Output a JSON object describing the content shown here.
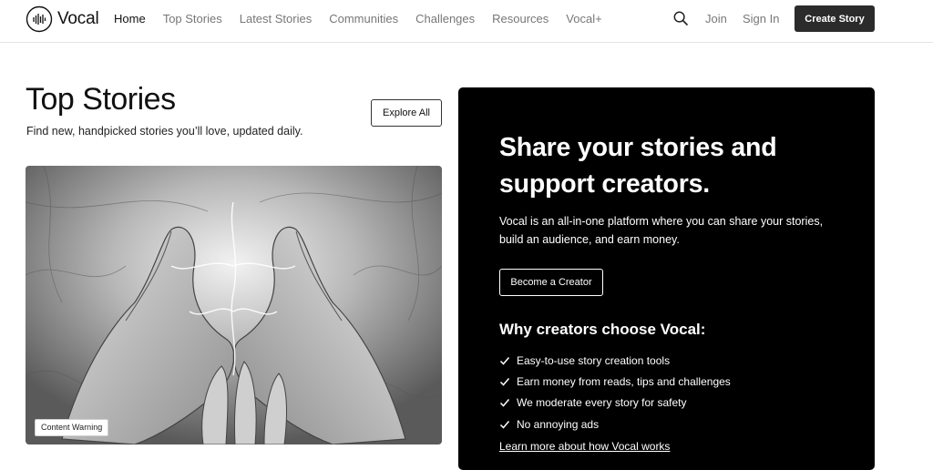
{
  "nav": {
    "logo_text": "Vocal",
    "links": [
      "Home",
      "Top Stories",
      "Latest Stories",
      "Communities",
      "Challenges",
      "Resources",
      "Vocal+"
    ],
    "active_link": "Home",
    "join": "Join",
    "sign_in": "Sign In",
    "create_story": "Create Story"
  },
  "top_stories": {
    "title": "Top Stories",
    "subtitle": "Find new, handpicked stories you’ll love, updated daily.",
    "explore_all": "Explore All",
    "featured_image_badge": "Content Warning"
  },
  "promo": {
    "title": "Share your stories and support creators.",
    "description": "Vocal is an all-in-one platform where you can share your stories, build an audience, and earn money.",
    "cta": "Become a Creator",
    "why_title": "Why creators choose Vocal:",
    "benefits": [
      "Easy-to-use story creation tools",
      "Earn money from reads, tips and challenges",
      "We moderate every story for safety",
      "No annoying ads"
    ],
    "learn_more": "Learn more about how Vocal works"
  },
  "icons": {
    "logo": "vocal-logo-icon",
    "search": "search-icon",
    "check": "check-icon"
  }
}
